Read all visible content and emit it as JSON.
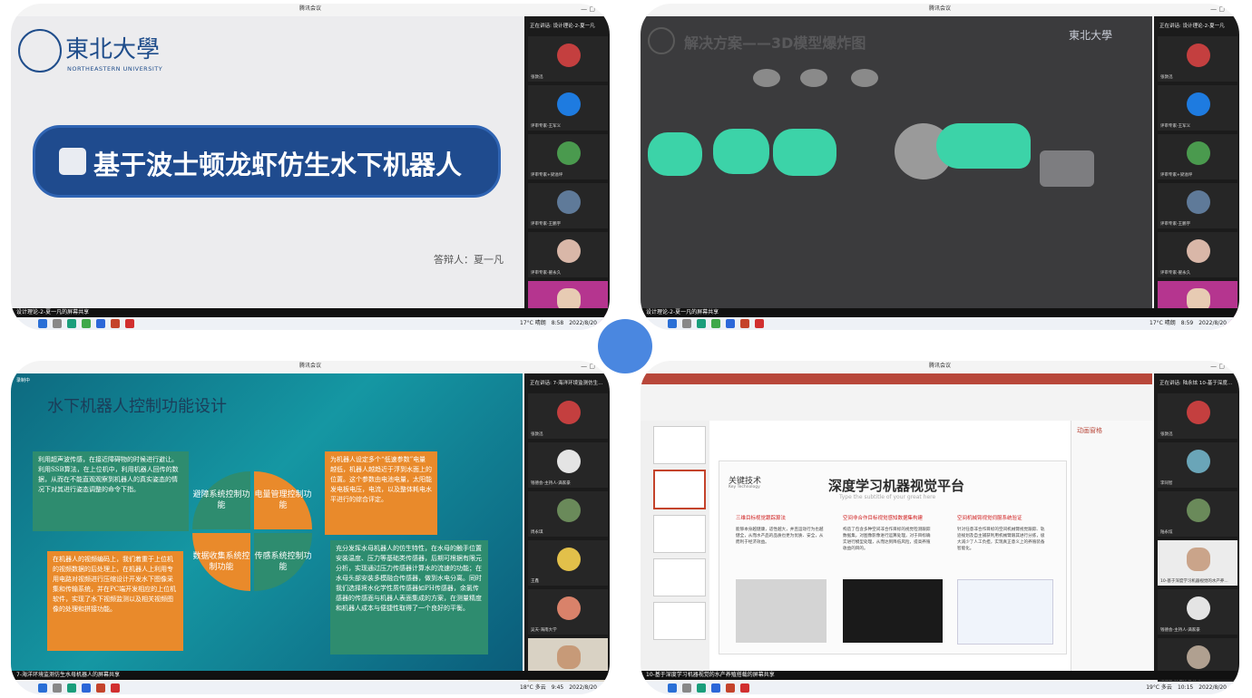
{
  "meeting_title": "腾讯会议",
  "q1": {
    "slide": {
      "logo_cn": "東北大學",
      "logo_en": "NORTHEASTERN UNIVERSITY",
      "title": "基于波士顿龙虾仿生水下机器人",
      "presenter": "答辩人：夏一凡"
    },
    "sidebar_header": "正在讲话: 设计理论-2-夏一凡",
    "participants": [
      "张敦迅",
      "评审专家-王军义",
      "评审专家+梁溢坪",
      "评审专家-王鹏宇",
      "评审专家-翟永久",
      "设计理论-2-夏一凡"
    ],
    "caption": "设计理论-2-夏一凡的屏幕共享",
    "weather": "17°C 晴朗",
    "time": "8:58",
    "date": "2022/8/20"
  },
  "q2": {
    "slide": {
      "title": "解决方案——3D模型爆炸图",
      "logo_right": "東北大學"
    },
    "sidebar_header": "正在讲话: 设计理论-2-夏一凡",
    "participants": [
      "张敦迅",
      "评审专家-王军义",
      "评审专家+梁溢坪",
      "评审专家-王鹏宇",
      "评审专家-翟永久",
      "设计理论-2-夏一凡"
    ],
    "caption": "设计理论-2-夏一凡的屏幕共享",
    "weather": "17°C 晴朗",
    "time": "8:59",
    "date": "2022/8/20"
  },
  "q3": {
    "slide": {
      "title": "水下机器人控制功能设计",
      "box_left_top": "利用超声波传感，在接近障碍物的时候进行避让。利用SSB算法，在上位机中，利用机器人回传的数据，从而在不能直观观察到机器人的真实姿态的情况下对其进行姿态调整的命令下指。",
      "box_right_top": "为机器人设定多个“低速参数”电量越低，机器人越趋近于浮到水面上的位置。这个参数由电池电量，太阳能发电板电压，电流，以及整体耗电水平进行的综合评定。",
      "box_left_bottom": "在机器人的视频编码上，我们着重于上位机的视频数据的后处理上，在机器人上利用专用电路对视频进行压缩设计开发水下图像采集和传输系统，并在PC端开发相应的上位机软件，实现了水下视频监测以及相关视频图像的处理和拼接功能。",
      "box_right_bottom": "充分发挥水母机器人的仿生特性，在水母的触手位置安装温度、压力等基础类传感器，后期可根据有限元分析，实现通过压力传感器计算水的流速的功能；在水母头部安装多模融合传感器，做到水电分离。同时我们选择将水化学性质传感器如PH传感器，余氯传感器的传感面与机器人表面集成的方案，在测量精度和机器人成本与便捷性取得了一个良好的平衡。",
      "sector1": "避障系统控制功能",
      "sector2": "电量管理控制功能",
      "sector3": "数据收集系统控制功能",
      "sector4": "传感系统控制功能"
    },
    "sidebar_header": "正在讲话: 7-海洋环境监测仿生...",
    "participants": [
      "张敦迅",
      "钱德会-主持人-满家豪",
      "周永琪",
      "王鑫",
      "吴天-海南大学",
      "7-海洋环境监测仿生水母机器人"
    ],
    "caption": "7-海洋环境监测仿生水母机器人的屏幕共享",
    "recording": "录制中",
    "weather": "18°C 多云",
    "time": "9:45",
    "date": "2022/8/20"
  },
  "q4": {
    "slide": {
      "key_label": "关键技术",
      "key_label_en": "Key Technology",
      "title": "深度学习机器视觉平台",
      "subtitle": "Type the subtitle of your great here",
      "col1_head": "三维目标视觉跟踪算法",
      "col2_head": "空间非合作目标视觉感知数据集构建",
      "col3_head": "空间机械臂视觉伺服系统验证",
      "col1_text": "能够本身越健康，适性越大，并且运动行为也越健全，从而水产品的品质也更为优质、安全，从而利于经济效益。",
      "col2_text": "构造了包含多种空间非合作目标的视觉检测跟踪数据集，对图像影像进行运算处理，对于目标确实进行模型处理，从而达到降低风险，提高养殖收益的目的。",
      "col3_text": "针对任意非合作目标的空间机械臂视觉跟踪、轨迹规划及自主捕获利用机械臂跟其进行分拣，极大减少了人工负担，实现真正意义上的养殖装备智能化。"
    },
    "animation_pane": "动画窗格",
    "sidebar_header": "正在讲话: 陆永炫 10-基于深度...",
    "participants": [
      "张敦迅",
      "李同智",
      "陆永炫",
      "10-基于深度学习机器视觉的水产养...",
      "钱德会-主持人-满家豪",
      "钱德会-赞理员-谷萌飞"
    ],
    "caption": "10-基于深度学习机器视觉的水产养殖搭载的屏幕共享",
    "weather": "19°C 多云",
    "time": "10:15",
    "date": "2022/8/20"
  },
  "colors": {
    "banner": "#1f4b8e",
    "teal_part": "#3cd3a8",
    "orange_box": "#e98a2b",
    "green_box": "#2e8c6f",
    "dot": "#4a87e0"
  }
}
